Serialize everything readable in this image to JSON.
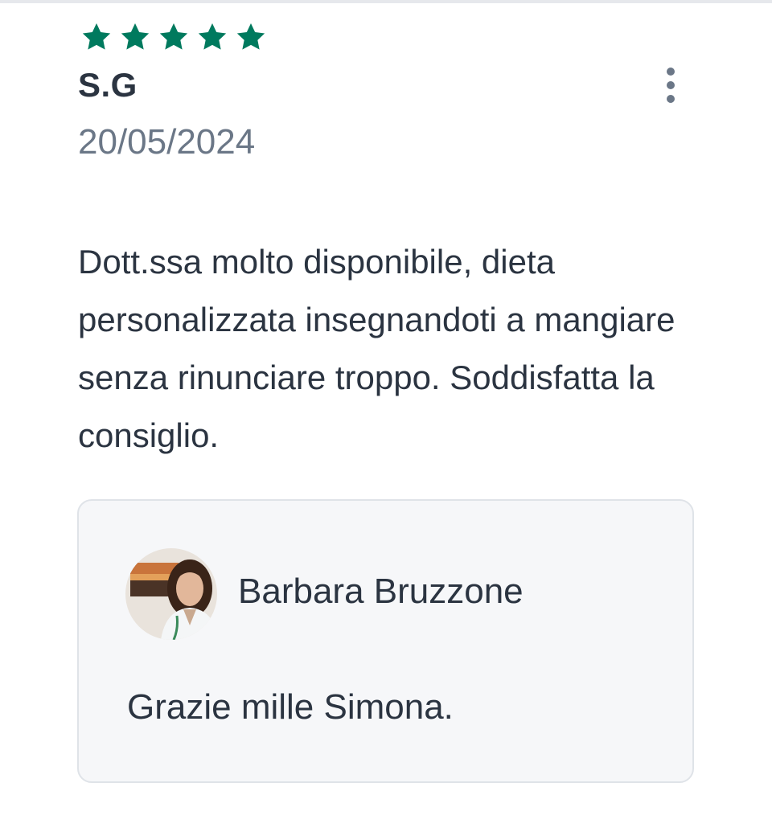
{
  "review": {
    "rating": 5,
    "rating_max": 5,
    "star_color": "#007a5e",
    "author": "S.G",
    "date": "20/05/2024",
    "text": "Dott.ssa molto disponibile, dieta personalizzata insegnandoti a mangiare senza rinunciare troppo. Soddisfatta la consiglio.",
    "more_icon": "more-vertical-icon"
  },
  "reply": {
    "author": "Barbara Bruzzone",
    "text": "Grazie mille Simona."
  }
}
